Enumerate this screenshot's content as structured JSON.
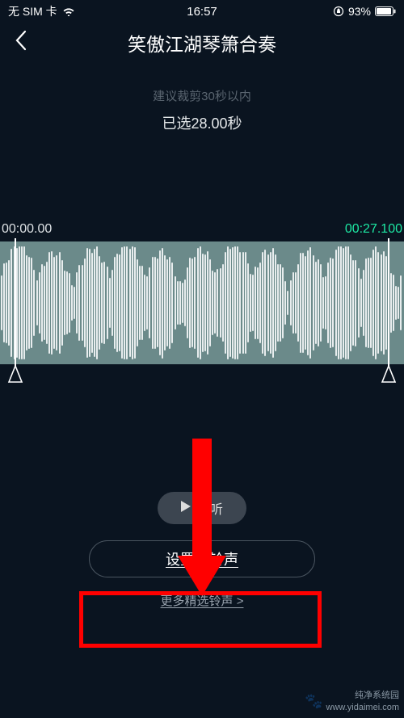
{
  "status": {
    "carrier": "无 SIM 卡",
    "time": "16:57",
    "battery_pct": "93%"
  },
  "header": {
    "title": "笑傲江湖琴箫合奏"
  },
  "editor": {
    "hint": "建议裁剪30秒以内",
    "selected_label": "已选28.00秒",
    "time_start": "00:00.00",
    "time_end": "00:27.100"
  },
  "buttons": {
    "preview": "试听",
    "set_ringtone": "设置为铃声",
    "more": "更多精选铃声 >"
  },
  "watermark": {
    "line1": "纯净系统园",
    "line2": "www.yidaimei.com"
  }
}
